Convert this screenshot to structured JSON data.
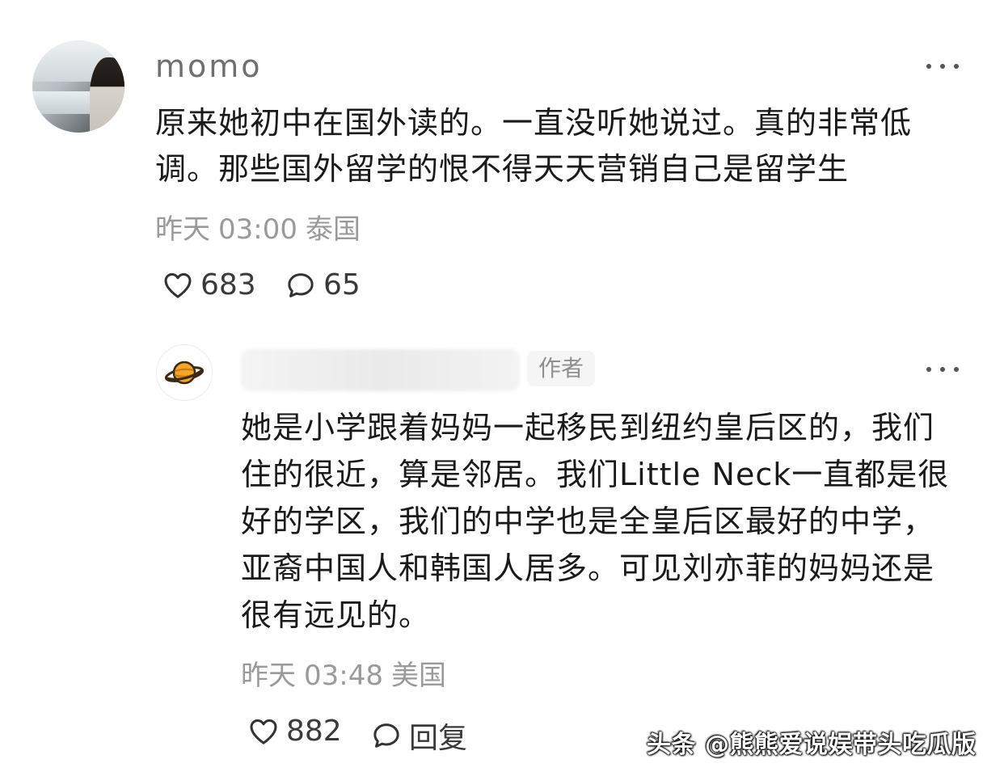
{
  "comment": {
    "username": "momo",
    "text": "原来她初中在国外读的。一直没听她说过。真的非常低调。那些国外留学的恨不得天天营销自己是留学生",
    "date": "昨天",
    "time": "03:00",
    "location": "泰国",
    "likes": "683",
    "replies": "65",
    "more_icon": "more-horizontal-icon"
  },
  "reply": {
    "author_badge": "作者",
    "text": "她是小学跟着妈妈一起移民到纽约皇后区的，我们住的很近，算是邻居。我们Little Neck一直都是很好的学区，我们的中学也是全皇后区最好的中学，亚裔中国人和韩国人居多。可见刘亦菲的妈妈还是很有远见的。",
    "date": "昨天",
    "time": "03:48",
    "location": "美国",
    "likes": "882",
    "reply_label": "回复",
    "avatar_icon": "planet-icon",
    "more_icon": "more-horizontal-icon"
  },
  "watermark": "头条 @熊熊爱说娱带头吃瓜版",
  "colors": {
    "text": "#1a1a1a",
    "meta": "#9a9a9a",
    "username": "#6f6f6f",
    "badge_bg": "#f5f5f5"
  }
}
